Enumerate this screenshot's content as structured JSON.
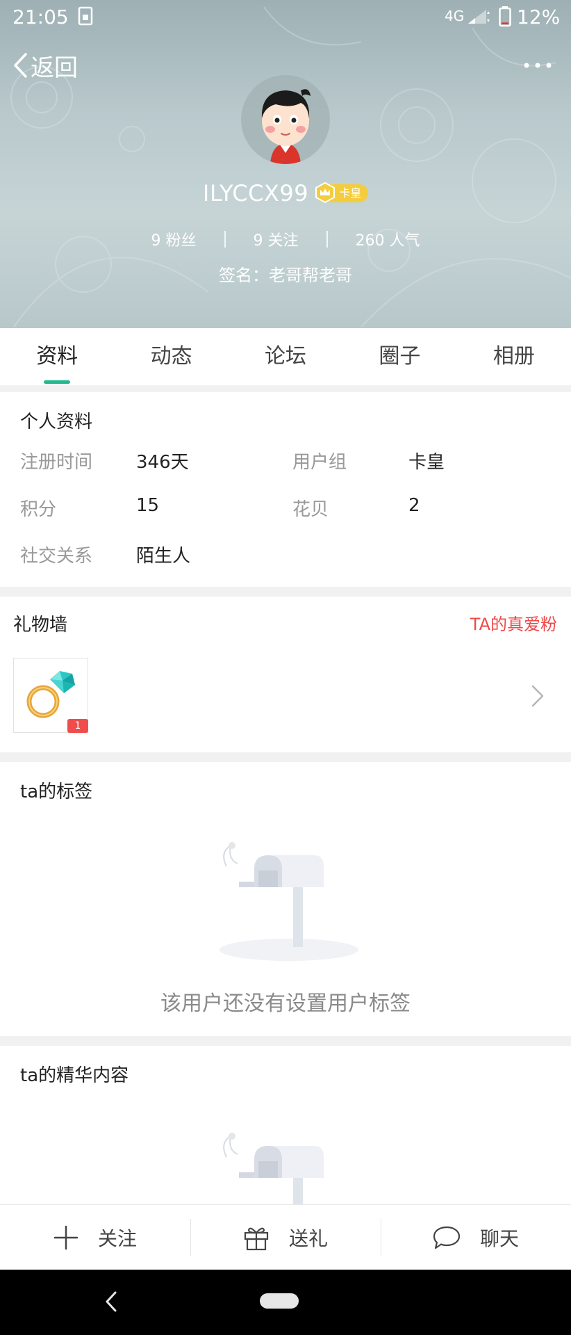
{
  "status_bar": {
    "time": "21:05",
    "network": "4G",
    "battery_percent": "12%",
    "battery_level": 0.12
  },
  "header": {
    "back_label": "返回",
    "username": "ILYCCX99",
    "vip_label": "卡皇",
    "stats": [
      {
        "label": "9 粉丝"
      },
      {
        "label": "9 关注"
      },
      {
        "label": "260 人气"
      }
    ],
    "signature": "签名：老哥帮老哥"
  },
  "tabs": [
    {
      "label": "资料",
      "active": true
    },
    {
      "label": "动态",
      "active": false
    },
    {
      "label": "论坛",
      "active": false
    },
    {
      "label": "圈子",
      "active": false
    },
    {
      "label": "相册",
      "active": false
    }
  ],
  "profile": {
    "title": "个人资料",
    "fields": [
      {
        "label": "注册时间",
        "value": "346天"
      },
      {
        "label": "用户组",
        "value": "卡皇"
      },
      {
        "label": "积分",
        "value": "15"
      },
      {
        "label": "花贝",
        "value": "2"
      },
      {
        "label": "社交关系",
        "value": "陌生人"
      }
    ]
  },
  "gifts": {
    "title": "礼物墙",
    "link": "TA的真爱粉",
    "items": [
      {
        "icon": "diamond-ring-icon",
        "count": "1"
      }
    ]
  },
  "tags": {
    "title": "ta的标签",
    "empty_text": "该用户还没有设置用户标签",
    "empty_icon": "mailbox-icon"
  },
  "best": {
    "title": "ta的精华内容",
    "empty_icon": "mailbox-icon"
  },
  "actions": [
    {
      "label": "关注",
      "icon": "plus-icon"
    },
    {
      "label": "送礼",
      "icon": "gift-icon"
    },
    {
      "label": "聊天",
      "icon": "chat-bubble-icon"
    }
  ],
  "colors": {
    "accent": "#22b98f",
    "link_red": "#f04848",
    "vip_gold": "#f3cd3e"
  }
}
